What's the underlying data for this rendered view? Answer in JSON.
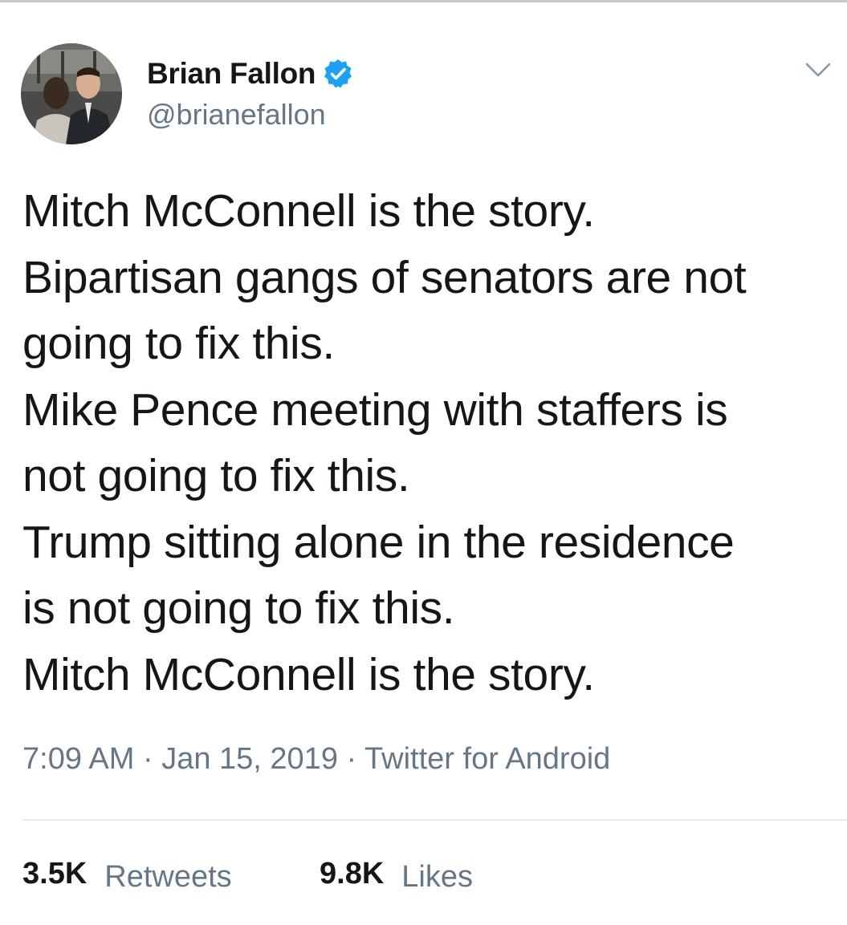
{
  "author": {
    "display_name": "Brian Fallon",
    "handle": "@brianefallon",
    "verified": true,
    "avatar_icon": "profile-photo-icon"
  },
  "tweet": {
    "lines": [
      "Mitch McConnell is the story.",
      "Bipartisan gangs of senators are not",
      "going to fix this.",
      "Mike Pence meeting with staffers is",
      "not going to fix this.",
      "Trump sitting alone in the residence",
      "is not going to fix this.",
      "Mitch McConnell is the story."
    ]
  },
  "meta": {
    "time": "7:09 AM",
    "separator": " · ",
    "date": "Jan 15, 2019",
    "source": "Twitter for Android"
  },
  "stats": {
    "retweets_count": "3.5K",
    "retweets_label": "Retweets",
    "likes_count": "9.8K",
    "likes_label": "Likes"
  },
  "colors": {
    "text": "#14171a",
    "secondary": "#657786",
    "verified_blue": "#1da1f2",
    "divider": "#e6ecf0"
  }
}
